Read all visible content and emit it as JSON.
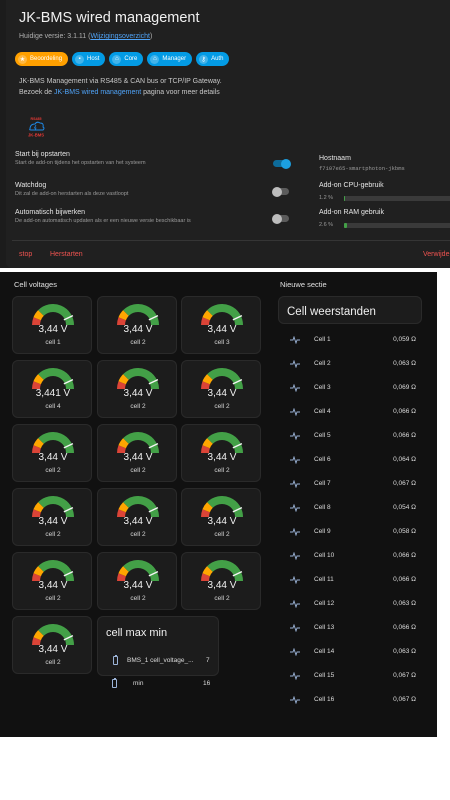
{
  "addon": {
    "title": "JK-BMS wired management",
    "version_prefix": "Huidige versie: 3.1.11 (",
    "version_link": "Wijzigingsoverzicht",
    "version_suffix": ")",
    "chips": [
      {
        "label": "Beoordeling",
        "icon": "star-icon",
        "color": "#ffa000"
      },
      {
        "label": "Host",
        "icon": "host-icon",
        "color": "#039be5"
      },
      {
        "label": "Core",
        "icon": "core-icon",
        "color": "#039be5"
      },
      {
        "label": "Manager",
        "icon": "manager-icon",
        "color": "#039be5"
      },
      {
        "label": "Auth",
        "icon": "key-icon",
        "color": "#039be5"
      }
    ],
    "description_line1": "JK-BMS Management via RS485 & CAN bus or TCP/IP Gateway.",
    "description_prefix": "Bezoek de ",
    "description_link": "JK-BMS wired management",
    "description_suffix": " pagina voor meer details",
    "logo_text_top": "RS485",
    "logo_text_bottom": "JK-BMS",
    "options": [
      {
        "title": "Start bij opstarten",
        "subtitle": "Start de add-on tijdens het opstarten van het systeem",
        "enabled": true
      },
      {
        "title": "Watchdog",
        "subtitle": "Dit zal de add-on herstarten als deze vastloopt",
        "enabled": false
      },
      {
        "title": "Automatisch bijwerken",
        "subtitle": "De add-on automatisch updaten als er een nieuwe versie beschikbaar is",
        "enabled": false
      }
    ],
    "hostname_label": "Hostnaam",
    "hostname_value": "f7107e65-smartphoton-jkbms",
    "cpu_label": "Add-on CPU-gebruik",
    "cpu_value": "1.2 %",
    "cpu_percent": 1.2,
    "ram_label": "Add-on RAM gebruik",
    "ram_value": "2.6 %",
    "ram_percent": 2.6,
    "actions": {
      "stop": "stop",
      "restart": "Herstarten",
      "uninstall": "Verwijde"
    }
  },
  "dashboard": {
    "cell_voltages_title": "Cell voltages",
    "new_section_title": "Nieuwe sectie",
    "gauge_level": 0.86,
    "gauges": [
      {
        "value": "3,44 V",
        "name": "cell 1"
      },
      {
        "value": "3,44 V",
        "name": "cell 2"
      },
      {
        "value": "3,44 V",
        "name": "cell 3"
      },
      {
        "value": "3,441 V",
        "name": "cell 4"
      },
      {
        "value": "3,44 V",
        "name": "cell 2"
      },
      {
        "value": "3,44 V",
        "name": "cell 2"
      },
      {
        "value": "3,44 V",
        "name": "cell 2"
      },
      {
        "value": "3,44 V",
        "name": "cell 2"
      },
      {
        "value": "3,44 V",
        "name": "cell 2"
      },
      {
        "value": "3,44 V",
        "name": "cell 2"
      },
      {
        "value": "3,44 V",
        "name": "cell 2"
      },
      {
        "value": "3,44 V",
        "name": "cell 2"
      },
      {
        "value": "3,44 V",
        "name": "cell 2"
      },
      {
        "value": "3,44 V",
        "name": "cell 2"
      },
      {
        "value": "3,44 V",
        "name": "cell 2"
      },
      {
        "value": "3,44 V",
        "name": "cell 2"
      }
    ],
    "cell_max_min": {
      "title": "cell max min",
      "rows": [
        {
          "name": "BMS_1 cell_voltage_...",
          "value": "7"
        },
        {
          "name": "min",
          "value": "16"
        }
      ]
    },
    "resistances": {
      "title": "Cell weerstanden",
      "rows": [
        {
          "name": "Cell 1",
          "value": "0,059 Ω"
        },
        {
          "name": "Cell 2",
          "value": "0,063 Ω"
        },
        {
          "name": "Cell 3",
          "value": "0,069 Ω"
        },
        {
          "name": "Cell 4",
          "value": "0,066 Ω"
        },
        {
          "name": "Cell 5",
          "value": "0,066 Ω"
        },
        {
          "name": "Cell 6",
          "value": "0,064 Ω"
        },
        {
          "name": "Cell 7",
          "value": "0,067 Ω"
        },
        {
          "name": "Cell 8",
          "value": "0,054 Ω"
        },
        {
          "name": "Cell 9",
          "value": "0,058 Ω"
        },
        {
          "name": "Cell 10",
          "value": "0,066 Ω"
        },
        {
          "name": "Cell 11",
          "value": "0,066 Ω"
        },
        {
          "name": "Cell 12",
          "value": "0,063 Ω"
        },
        {
          "name": "Cell 13",
          "value": "0,066 Ω"
        },
        {
          "name": "Cell 14",
          "value": "0,063 Ω"
        },
        {
          "name": "Cell 15",
          "value": "0,067 Ω"
        },
        {
          "name": "Cell 16",
          "value": "0,067 Ω"
        }
      ]
    }
  }
}
